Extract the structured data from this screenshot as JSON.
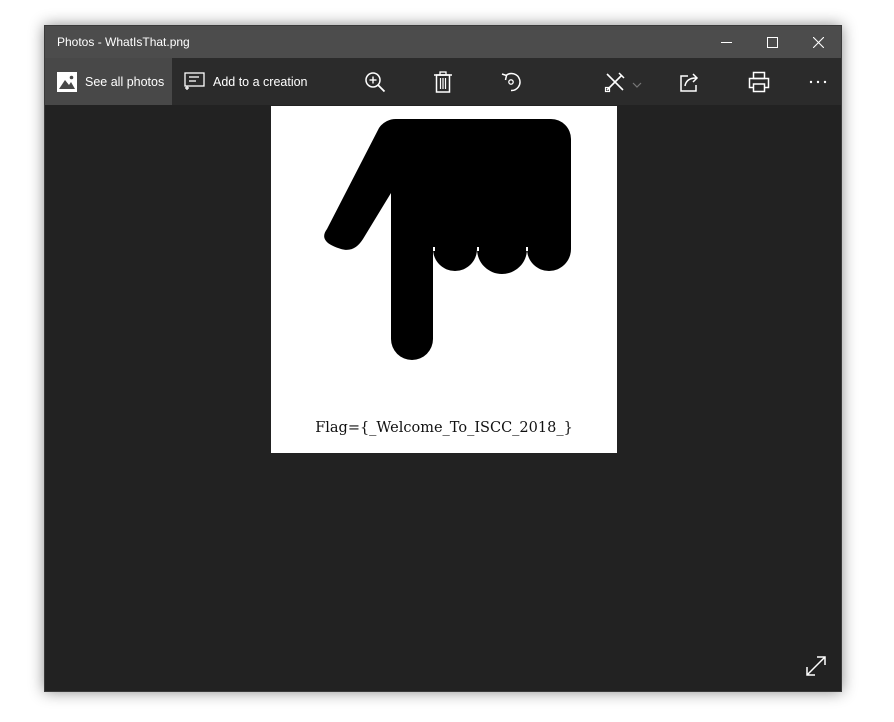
{
  "window": {
    "title": "Photos - WhatIsThat.png"
  },
  "toolbar": {
    "see_all_photos_label": "See all photos",
    "add_to_creation_label": "Add to a creation"
  },
  "image": {
    "caption_text": "Flag={_Welcome_To_ISCC_2018_}"
  },
  "icons": {
    "minimize": "minimize-icon",
    "maximize": "maximize-icon",
    "close": "close-icon",
    "see_all_photos": "photos-icon",
    "add_to_creation": "creation-icon",
    "zoom": "zoom-in-icon",
    "delete": "trash-icon",
    "rotate": "rotate-icon",
    "edit": "edit-create-icon",
    "share": "share-icon",
    "print": "print-icon",
    "more": "more-icon",
    "expand": "fullscreen-icon"
  },
  "colors": {
    "titlebar": "#4c4c4c",
    "toolbar": "#2b2b2b",
    "toolbar_active": "#484848",
    "background": "#222222"
  }
}
